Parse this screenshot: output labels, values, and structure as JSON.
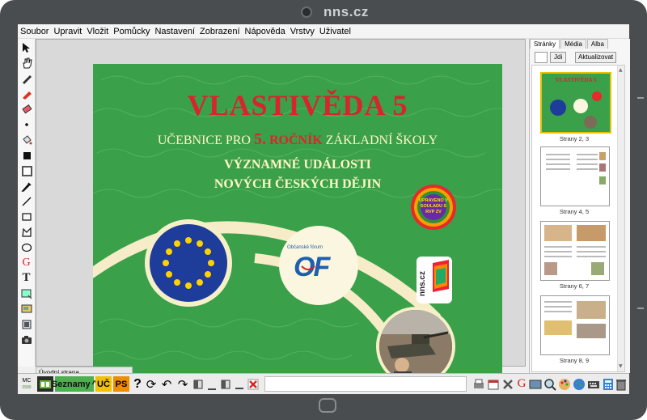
{
  "device": {
    "brand": "nns.cz"
  },
  "menu": [
    "Soubor",
    "Upravit",
    "Vložit",
    "Pomůcky",
    "Nastavení",
    "Zobrazení",
    "Nápověda",
    "Vrstvy",
    "Uživatel"
  ],
  "cover": {
    "title": "VLASTIVĚDA 5",
    "sub_pre": "UČEBNICE PRO",
    "sub_num": "5.",
    "sub_rocnik": "ROČNÍK",
    "sub_post": "ZÁKLADNÍ ŠKOLY",
    "line1": "VÝZNAMNÉ UDÁLOSTI",
    "line2": "NOVÝCH ČESKÝCH DĚJIN",
    "badge": "UPRAVENO V SOULADU S RVP ZV",
    "of_label": "Občanské fórum",
    "of_letters": "OF",
    "nns": "nns.cz"
  },
  "status_tab": "Úvodní strana",
  "bottom": {
    "mc": "MC",
    "mc_sub": "0580",
    "seznamy": "Seznamy",
    "uc": "UČ",
    "ps": "PS",
    "up_arrow": "^"
  },
  "panel": {
    "tabs": [
      "Stránky",
      "Média",
      "Alba"
    ],
    "go": "Jdi",
    "refresh": "Aktualizovat",
    "thumbs": [
      "Strany 2, 3",
      "Strany 4, 5",
      "Strany 6, 7",
      "Strany 8, 9"
    ]
  },
  "colors": {
    "cover_green": "#3aa04a",
    "title_red": "#d8242b",
    "seznamy_green": "#4caf50",
    "uc_yellow": "#f2c200",
    "ps_orange": "#f08c00"
  }
}
